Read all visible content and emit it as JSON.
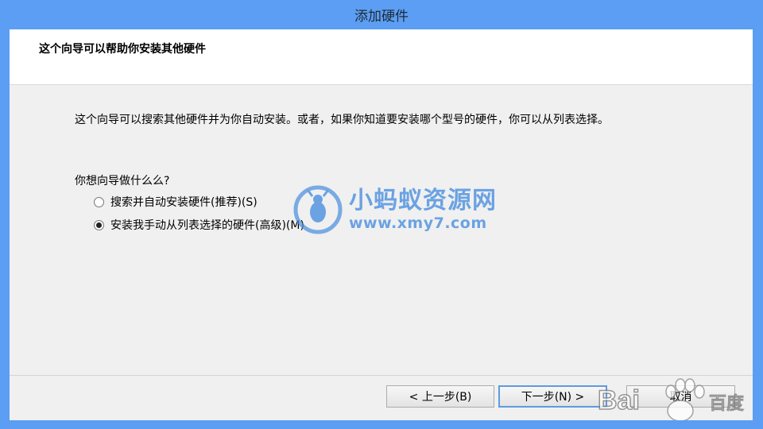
{
  "window": {
    "title": "添加硬件"
  },
  "header": {
    "title": "这个向导可以帮助你安装其他硬件"
  },
  "body": {
    "description": "这个向导可以搜索其他硬件并为你自动安装。或者，如果你知道要安装哪个型号的硬件，你可以从列表选择。",
    "question": "你想向导做什么么?",
    "options": [
      {
        "label": "搜索并自动安装硬件(推荐)(S)",
        "selected": false
      },
      {
        "label": "安装我手动从列表选择的硬件(高级)(M)",
        "selected": true
      }
    ]
  },
  "buttons": {
    "back_label": "< 上一步(B)",
    "next_label": "下一步(N) >",
    "cancel_label": "取消"
  },
  "watermark": {
    "name": "小蚂蚁资源网",
    "url": "www.xmy7.com",
    "baidu": "Bai 百度"
  },
  "colors": {
    "window_border": "#5b9ef3",
    "client_bg": "#f0f0f0",
    "header_bg": "#ffffff",
    "watermark": "#4a8fdf",
    "default_button_border": "#5e9be0"
  },
  "icons": {
    "radio_unselected": "radio-empty-icon",
    "radio_selected": "radio-filled-icon",
    "watermark_logo": "ant-logo-icon",
    "baidu_logo": "baidu-paw-icon"
  }
}
